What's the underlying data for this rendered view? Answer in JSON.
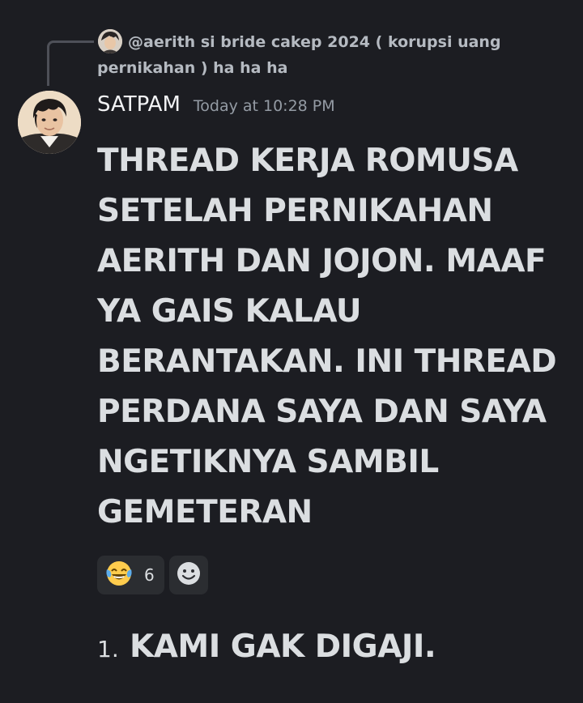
{
  "reply": {
    "mention": "@aerith si bride cakep 2024",
    "text": "( korupsi uang pernikahan ) ha ha ha"
  },
  "message": {
    "username": "SATPAM",
    "timestamp": "Today at 10:28 PM",
    "body": "THREAD KERJA ROMUSA SETELAH PERNIKAHAN AERITH DAN JOJON. MAAF YA GAIS KALAU BERANTAKAN. INI THREAD PERDANA SAYA DAN SAYA NGETIKNYA SAMBIL GEMETERAN"
  },
  "reactions": [
    {
      "emoji": "😂",
      "icon": "laughing-tears-emoji",
      "count": "6"
    }
  ],
  "add_reaction_icon": "smiley-add-reaction-icon",
  "list": [
    {
      "number": "1.",
      "text": "KAMI GAK DIGAJI."
    }
  ]
}
